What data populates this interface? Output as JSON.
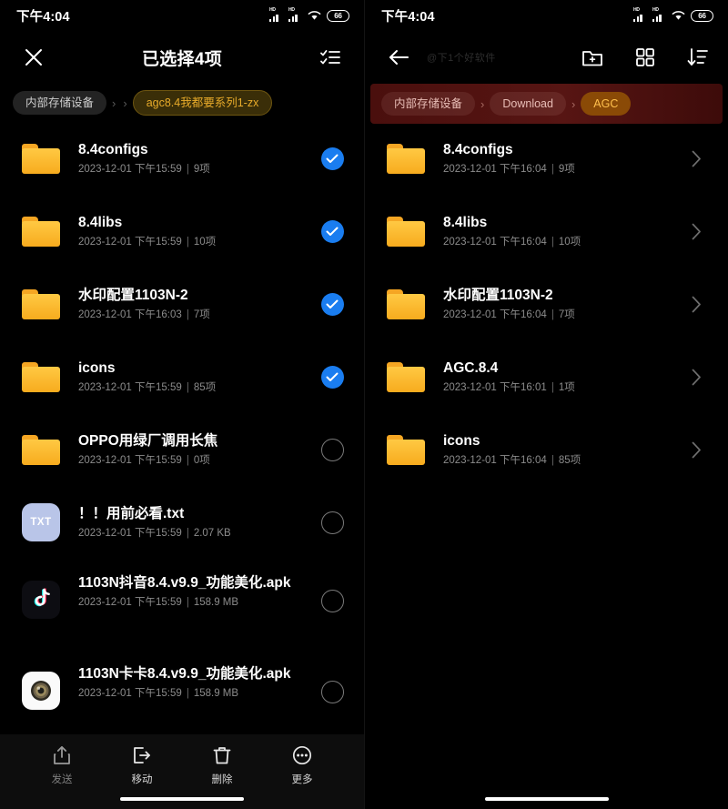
{
  "left": {
    "statusbar": {
      "time": "下午4:04",
      "signal_label": "HD",
      "battery_level": "66",
      "icons": [
        "signal-hd-icon",
        "signal-hd-icon",
        "wifi-icon",
        "battery-icon"
      ]
    },
    "appbar": {
      "close_icon": "close-icon",
      "title": "已选择4项",
      "select_all_icon": "select-all-icon"
    },
    "breadcrumb": {
      "items": [
        {
          "label": "内部存储设备",
          "style": "grey"
        },
        {
          "label": "agc8.4我都要系列1-zx",
          "style": "active-gold"
        }
      ],
      "separator": "›",
      "collapsed_separator": "›"
    },
    "files": [
      {
        "name": "8.4configs",
        "date": "2023-12-01 下午15:59",
        "info": "9项",
        "icon": "folder-icon",
        "selected": true
      },
      {
        "name": "8.4libs",
        "date": "2023-12-01 下午15:59",
        "info": "10项",
        "icon": "folder-icon",
        "selected": true
      },
      {
        "name": "水印配置1103N-2",
        "date": "2023-12-01 下午16:03",
        "info": "7项",
        "icon": "folder-icon",
        "selected": true
      },
      {
        "name": "icons",
        "date": "2023-12-01 下午15:59",
        "info": "85项",
        "icon": "folder-icon",
        "selected": true
      },
      {
        "name": "OPPO用绿厂调用长焦",
        "date": "2023-12-01 下午15:59",
        "info": "0项",
        "icon": "folder-icon",
        "selected": false
      },
      {
        "name": "！！用前必看.txt",
        "date": "2023-12-01 下午15:59",
        "info": "2.07 KB",
        "icon": "txt-file-icon",
        "selected": false
      },
      {
        "name": "1103N抖音8.4.v9.9_功能美化.apk",
        "date": "2023-12-01 下午15:59",
        "info": "158.9 MB",
        "icon": "tiktok-apk-icon",
        "selected": false
      },
      {
        "name": "1103N卡卡8.4.v9.9_功能美化.apk",
        "date": "2023-12-01 下午15:59",
        "info": "158.9 MB",
        "icon": "camera-apk-icon",
        "selected": false
      }
    ],
    "toolbar": [
      {
        "label": "发送",
        "icon": "share-icon",
        "dim": true
      },
      {
        "label": "移动",
        "icon": "move-icon",
        "dim": false
      },
      {
        "label": "删除",
        "icon": "trash-icon",
        "dim": false
      },
      {
        "label": "更多",
        "icon": "more-icon",
        "dim": false
      }
    ]
  },
  "right": {
    "statusbar": {
      "time": "下午4:04",
      "signal_label": "HD",
      "battery_level": "66",
      "icons": [
        "signal-hd-icon",
        "signal-hd-icon",
        "wifi-icon",
        "battery-icon"
      ]
    },
    "appbar": {
      "back_icon": "back-arrow-icon",
      "watermark": "@下1个好软件",
      "new_folder_icon": "new-folder-icon",
      "grid_view_icon": "grid-view-icon",
      "sort_icon": "sort-descending-icon"
    },
    "breadcrumb": {
      "items": [
        {
          "label": "内部存储设备",
          "style": "ghost-red"
        },
        {
          "label": "Download",
          "style": "ghost-red"
        },
        {
          "label": "AGC",
          "style": "active-amber"
        }
      ],
      "separator": "›"
    },
    "files": [
      {
        "name": "8.4configs",
        "date": "2023-12-01 下午16:04",
        "info": "9项",
        "icon": "folder-icon"
      },
      {
        "name": "8.4libs",
        "date": "2023-12-01 下午16:04",
        "info": "10项",
        "icon": "folder-icon"
      },
      {
        "name": "水印配置1103N-2",
        "date": "2023-12-01 下午16:04",
        "info": "7项",
        "icon": "folder-icon"
      },
      {
        "name": "AGC.8.4",
        "date": "2023-12-01 下午16:01",
        "info": "1项",
        "icon": "folder-icon"
      },
      {
        "name": "icons",
        "date": "2023-12-01 下午16:04",
        "info": "85项",
        "icon": "folder-icon"
      }
    ],
    "chevron": "›"
  },
  "colors": {
    "folder": "#f7b32b",
    "check_blue": "#1a7df0",
    "crumb_gold": "#e8ab2a",
    "crumb_amber": "#ffc04d",
    "crumb_bar_red": "#571513",
    "background": "#000000"
  }
}
